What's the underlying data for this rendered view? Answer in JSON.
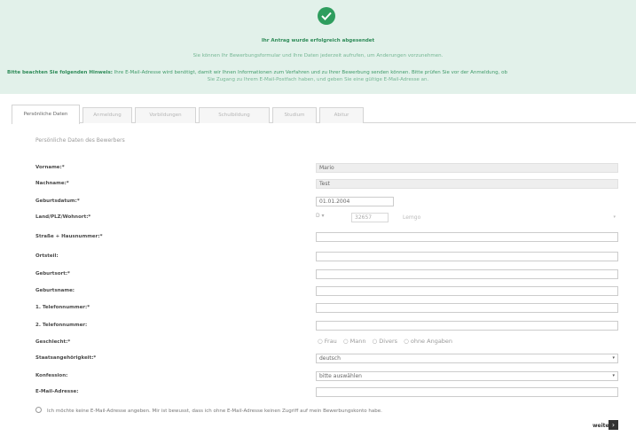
{
  "banner": {
    "title": "Ihr Antrag wurde erfolgreich abgesendet",
    "subtitle": "Sie können Ihr Bewerbungsformular und Ihre Daten jederzeit aufrufen, um Änderungen vorzunehmen.",
    "hint_label": "Bitte beachten Sie folgenden Hinweis:",
    "hint_text": "Ihre E-Mail-Adresse wird benötigt, damit wir Ihnen Informationen zum Verfahren und zu Ihrer Bewerbung senden können. Bitte prüfen Sie vor der Anmeldung, ob",
    "hint_text2": "Sie Zugang zu Ihrem E-Mail-Postfach haben, und geben Sie eine gültige E-Mail-Adresse an."
  },
  "tabs": [
    {
      "label": "Persönliche Daten"
    },
    {
      "label": "Anmeldung"
    },
    {
      "label": "Vorbildungen"
    },
    {
      "label": "Schulbildung"
    },
    {
      "label": "Studium"
    },
    {
      "label": "Abitur"
    }
  ],
  "section_label": "Persönliche Daten des Bewerbers",
  "form": {
    "vorname": {
      "label": "Vorname:*",
      "value": "Mario"
    },
    "nachname": {
      "label": "Nachname:*",
      "value": "Test"
    },
    "geburtsdatum": {
      "label": "Geburtsdatum:*",
      "value": "01.01.2004"
    },
    "wohnort": {
      "label": "Land/PLZ/Wohnort:*",
      "country": "D",
      "plz": "32657",
      "city": "Lemgo"
    },
    "strasse": {
      "label": "Straße + Hausnummer:*",
      "value": ""
    },
    "ortsteil": {
      "label": "Ortsteil:",
      "value": ""
    },
    "geburtsort": {
      "label": "Geburtsort:*",
      "value": ""
    },
    "geburtsname": {
      "label": "Geburtsname:",
      "value": ""
    },
    "telefon1": {
      "label": "1. Telefonnummer:*",
      "value": ""
    },
    "telefon2": {
      "label": "2. Telefonnummer:",
      "value": ""
    },
    "geschlecht": {
      "label": "Geschlecht:*",
      "options": [
        "Frau",
        "Mann",
        "Divers",
        "ohne Angaben"
      ]
    },
    "staatsangehoerigkeit": {
      "label": "Staatsangehörigkeit:*",
      "value": "deutsch"
    },
    "konfession": {
      "label": "Konfession:",
      "value": "bitte auswählen"
    },
    "email": {
      "label": "E-Mail-Adresse:",
      "value": ""
    }
  },
  "optin_text": "Ich möchte keine E-Mail-Adresse angeben. Mir ist bewusst, dass ich ohne E-Mail-Adresse keinen Zugriff auf mein Bewerbungskonto habe.",
  "next_label": "weiter"
}
